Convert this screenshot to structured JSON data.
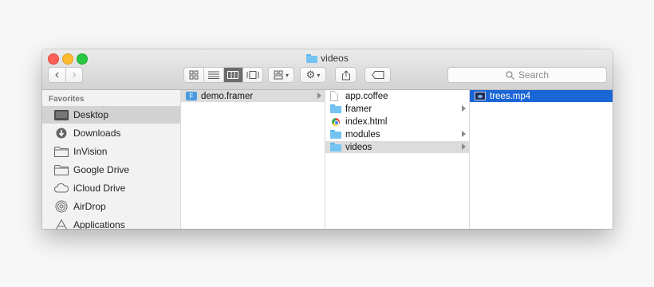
{
  "window": {
    "title": "videos"
  },
  "toolbar": {
    "back": "‹",
    "forward": "›",
    "view_icons": [
      "icon-view",
      "list-view",
      "column-view",
      "cover-flow-view"
    ],
    "active_view": "column-view",
    "arrange": "group-arrange",
    "action": "gear-action",
    "share": "share",
    "tags": "tag"
  },
  "search": {
    "placeholder": "Search"
  },
  "sidebar": {
    "heading": "Favorites",
    "items": [
      {
        "label": "Desktop",
        "icon": "desktop-icon",
        "selected": true
      },
      {
        "label": "Downloads",
        "icon": "downloads-icon"
      },
      {
        "label": "InVision",
        "icon": "folder-icon"
      },
      {
        "label": "Google Drive",
        "icon": "folder-icon"
      },
      {
        "label": "iCloud Drive",
        "icon": "cloud-icon"
      },
      {
        "label": "AirDrop",
        "icon": "airdrop-icon"
      },
      {
        "label": "Applications",
        "icon": "applications-icon"
      }
    ]
  },
  "columns": [
    {
      "items": [
        {
          "name": "demo.framer",
          "type": "framer",
          "has_children": true,
          "selected": "gray"
        }
      ]
    },
    {
      "items": [
        {
          "name": "app.coffee",
          "type": "file"
        },
        {
          "name": "framer",
          "type": "folder",
          "has_children": true
        },
        {
          "name": "index.html",
          "type": "chrome"
        },
        {
          "name": "modules",
          "type": "folder",
          "has_children": true
        },
        {
          "name": "videos",
          "type": "folder",
          "has_children": true,
          "selected": "gray"
        }
      ]
    },
    {
      "items": [
        {
          "name": "trees.mp4",
          "type": "video",
          "selected": "blue"
        }
      ]
    }
  ],
  "colors": {
    "selection_blue": "#1b66d6",
    "folder": "#74c3f3"
  }
}
